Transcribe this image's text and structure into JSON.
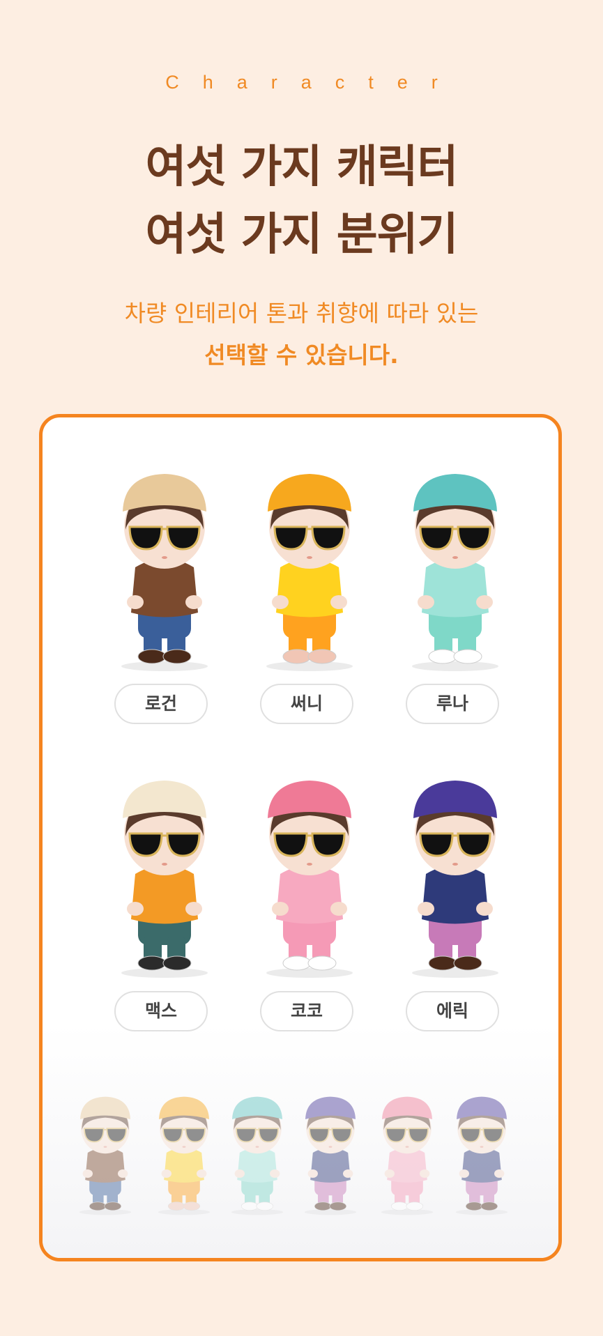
{
  "header": {
    "eyebrow": "Character",
    "title_line1": "여섯 가지 캐릭터",
    "title_line2": "여섯 가지 분위기",
    "subtitle_line1": "차량 인테리어 톤과 취향에 따라 있는",
    "subtitle_line2": "선택할 수 있습니다."
  },
  "colors": {
    "background": "#fdeee2",
    "accent": "#f5841f",
    "title": "#6b3a1f"
  },
  "characters": [
    {
      "name": "로건",
      "hat": "#e8c99a",
      "top": "#7b4a2e",
      "bottom": "#3a5f9a",
      "shoes": "#4a2a1a"
    },
    {
      "name": "써니",
      "hat": "#f7a81e",
      "top": "#ffd21f",
      "bottom": "#ffa21f",
      "shoes": "#f1c6b5"
    },
    {
      "name": "루나",
      "hat": "#5ec3c0",
      "top": "#9ee3d8",
      "bottom": "#7fd8c8",
      "shoes": "#ffffff"
    },
    {
      "name": "맥스",
      "hat": "#f3e7cf",
      "top": "#f39a25",
      "bottom": "#3b6b6a",
      "shoes": "#2b2b2b"
    },
    {
      "name": "코코",
      "hat": "#ef7a96",
      "top": "#f7a9c0",
      "bottom": "#f59ab6",
      "shoes": "#ffffff"
    },
    {
      "name": "에릭",
      "hat": "#4a3a9a",
      "top": "#2e3a7a",
      "bottom": "#c77ab8",
      "shoes": "#4a2a1a"
    }
  ]
}
